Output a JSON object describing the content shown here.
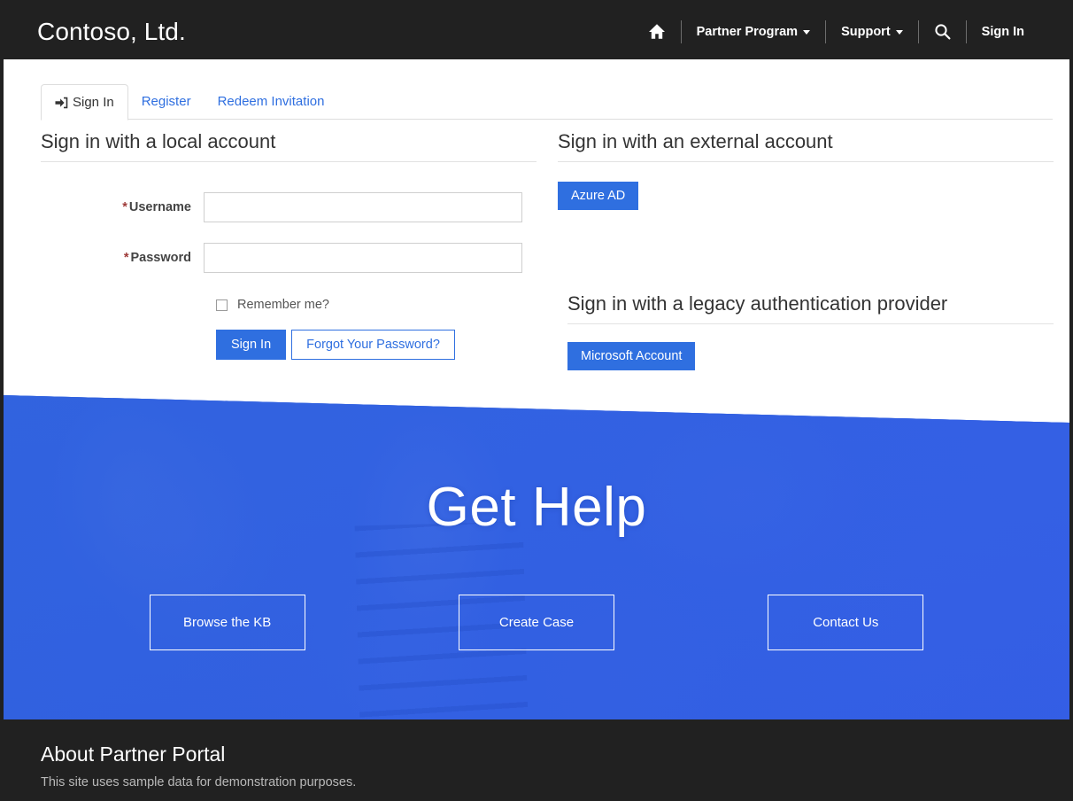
{
  "brand": {
    "name": "Contoso, Ltd."
  },
  "colors": {
    "accent_blue": "#2F6FE0",
    "hero_blue": "#3566E2",
    "dark_bar": "#212121",
    "required_red": "#9E3A38",
    "link_blue": "#2F6FE0"
  },
  "navbar": {
    "home_icon": "home-icon",
    "items": [
      {
        "label": "Partner Program",
        "has_caret": true
      },
      {
        "label": "Support",
        "has_caret": true
      }
    ],
    "search_icon": "search-icon",
    "signin_label": "Sign In"
  },
  "tabs": [
    {
      "label": "Sign In",
      "icon": "sign-in-icon",
      "active": true
    },
    {
      "label": "Register",
      "icon": null,
      "active": false
    },
    {
      "label": "Redeem Invitation",
      "icon": null,
      "active": false
    }
  ],
  "local_signin": {
    "heading": "Sign in with a local account",
    "username": {
      "label": "Username",
      "required_marker": "*",
      "value": "",
      "placeholder": ""
    },
    "password": {
      "label": "Password",
      "required_marker": "*",
      "value": "",
      "placeholder": ""
    },
    "remember_me": {
      "label": "Remember me?",
      "checked": false
    },
    "submit_label": "Sign In",
    "forgot_label": "Forgot Your Password?"
  },
  "external_signin": {
    "heading": "Sign in with an external account",
    "providers": [
      {
        "label": "Azure AD"
      }
    ]
  },
  "legacy_signin": {
    "heading": "Sign in with a legacy authentication provider",
    "providers": [
      {
        "label": "Microsoft Account"
      }
    ]
  },
  "hero": {
    "title": "Get Help",
    "buttons": [
      {
        "label": "Browse the KB"
      },
      {
        "label": "Create Case"
      },
      {
        "label": "Contact Us"
      }
    ]
  },
  "footer": {
    "title": "About Partner Portal",
    "text": "This site uses sample data for demonstration purposes."
  }
}
